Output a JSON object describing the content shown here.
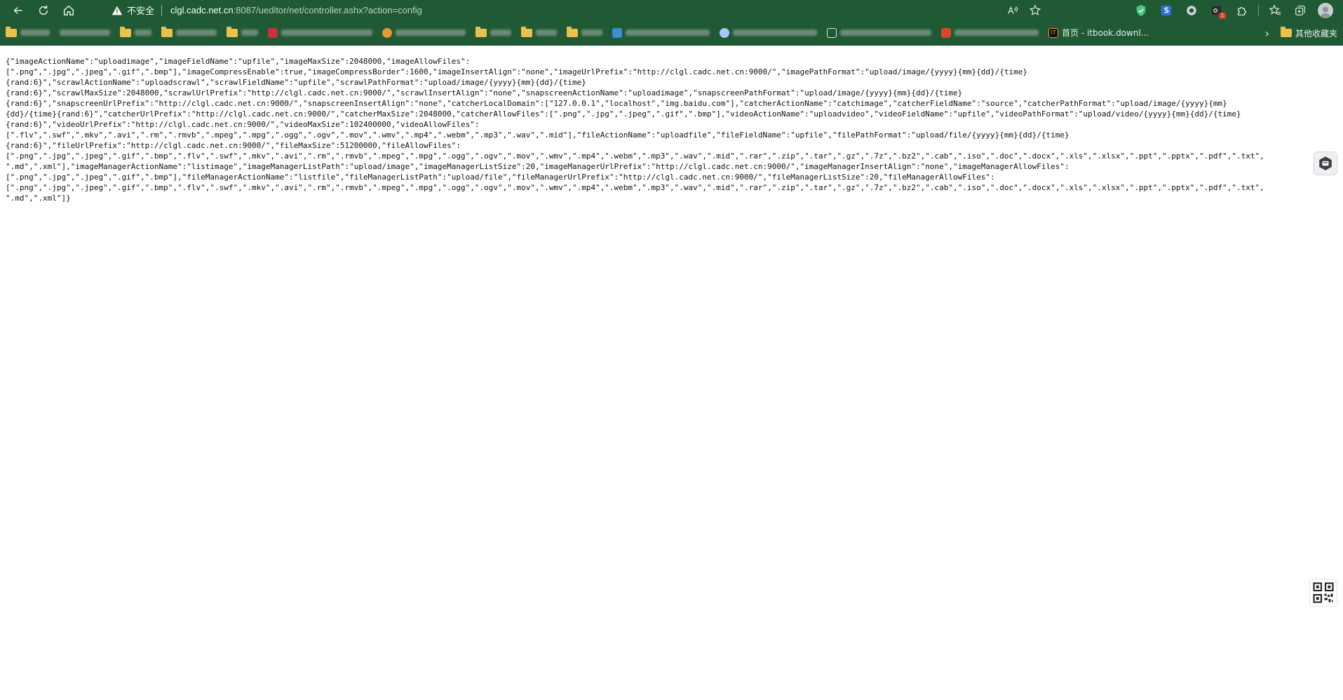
{
  "toolbar": {
    "back_icon": "back-arrow-icon",
    "reload_icon": "reload-icon",
    "home_icon": "home-icon",
    "security_label": "不安全",
    "url_host": "clgl.cadc.net.cn",
    "url_path": ":8087/ueditor/net/controller.ashx?action=config",
    "read_aloud_icon": "read-aloud-icon",
    "add_favorite_icon": "star-add-icon"
  },
  "extensions": [
    "shield-extension-icon",
    "s-extension-icon",
    "circle-extension-icon",
    "badge-extension-icon",
    "puzzle-extension-icon",
    "favorites-icon",
    "collections-icon",
    "profile-avatar-icon"
  ],
  "bookmarks": {
    "named_item": "首页 - itbook.downl...",
    "other_favorites": "其他收藏夹"
  },
  "content": {
    "json_text": "{\"imageActionName\":\"uploadimage\",\"imageFieldName\":\"upfile\",\"imageMaxSize\":2048000,\"imageAllowFiles\":\n[\".png\",\".jpg\",\".jpeg\",\".gif\",\".bmp\"],\"imageCompressEnable\":true,\"imageCompressBorder\":1600,\"imageInsertAlign\":\"none\",\"imageUrlPrefix\":\"http://clgl.cadc.net.cn:9000/\",\"imagePathFormat\":\"upload/image/{yyyy}{mm}{dd}/{time}\n{rand:6}\",\"scrawlActionName\":\"uploadscrawl\",\"scrawlFieldName\":\"upfile\",\"scrawlPathFormat\":\"upload/image/{yyyy}{mm}{dd}/{time}\n{rand:6}\",\"scrawlMaxSize\":2048000,\"scrawlUrlPrefix\":\"http://clgl.cadc.net.cn:9000/\",\"scrawlInsertAlign\":\"none\",\"snapscreenActionName\":\"uploadimage\",\"snapscreenPathFormat\":\"upload/image/{yyyy}{mm}{dd}/{time}\n{rand:6}\",\"snapscreenUrlPrefix\":\"http://clgl.cadc.net.cn:9000/\",\"snapscreenInsertAlign\":\"none\",\"catcherLocalDomain\":[\"127.0.0.1\",\"localhost\",\"img.baidu.com\"],\"catcherActionName\":\"catchimage\",\"catcherFieldName\":\"source\",\"catcherPathFormat\":\"upload/image/{yyyy}{mm}\n{dd}/{time}{rand:6}\",\"catcherUrlPrefix\":\"http://clgl.cadc.net.cn:9000/\",\"catcherMaxSize\":2048000,\"catcherAllowFiles\":[\".png\",\".jpg\",\".jpeg\",\".gif\",\".bmp\"],\"videoActionName\":\"uploadvideo\",\"videoFieldName\":\"upfile\",\"videoPathFormat\":\"upload/video/{yyyy}{mm}{dd}/{time}\n{rand:6}\",\"videoUrlPrefix\":\"http://clgl.cadc.net.cn:9000/\",\"videoMaxSize\":102400000,\"videoAllowFiles\":\n[\".flv\",\".swf\",\".mkv\",\".avi\",\".rm\",\".rmvb\",\".mpeg\",\".mpg\",\".ogg\",\".ogv\",\".mov\",\".wmv\",\".mp4\",\".webm\",\".mp3\",\".wav\",\".mid\"],\"fileActionName\":\"uploadfile\",\"fileFieldName\":\"upfile\",\"filePathFormat\":\"upload/file/{yyyy}{mm}{dd}/{time}\n{rand:6}\",\"fileUrlPrefix\":\"http://clgl.cadc.net.cn:9000/\",\"fileMaxSize\":51200000,\"fileAllowFiles\":\n[\".png\",\".jpg\",\".jpeg\",\".gif\",\".bmp\",\".flv\",\".swf\",\".mkv\",\".avi\",\".rm\",\".rmvb\",\".mpeg\",\".mpg\",\".ogg\",\".ogv\",\".mov\",\".wmv\",\".mp4\",\".webm\",\".mp3\",\".wav\",\".mid\",\".rar\",\".zip\",\".tar\",\".gz\",\".7z\",\".bz2\",\".cab\",\".iso\",\".doc\",\".docx\",\".xls\",\".xlsx\",\".ppt\",\".pptx\",\".pdf\",\".txt\",\n\".md\",\".xml\"],\"imageManagerActionName\":\"listimage\",\"imageManagerListPath\":\"upload/image\",\"imageManagerListSize\":20,\"imageManagerUrlPrefix\":\"http://clgl.cadc.net.cn:9000/\",\"imageManagerInsertAlign\":\"none\",\"imageManagerAllowFiles\":\n[\".png\",\".jpg\",\".jpeg\",\".gif\",\".bmp\"],\"fileManagerActionName\":\"listfile\",\"fileManagerListPath\":\"upload/file\",\"fileManagerUrlPrefix\":\"http://clgl.cadc.net.cn:9000/\",\"fileManagerListSize\":20,\"fileManagerAllowFiles\":\n[\".png\",\".jpg\",\".jpeg\",\".gif\",\".bmp\",\".flv\",\".swf\",\".mkv\",\".avi\",\".rm\",\".rmvb\",\".mpeg\",\".mpg\",\".ogg\",\".ogv\",\".mov\",\".wmv\",\".mp4\",\".webm\",\".mp3\",\".wav\",\".mid\",\".rar\",\".zip\",\".tar\",\".gz\",\".7z\",\".bz2\",\".cab\",\".iso\",\".doc\",\".docx\",\".xls\",\".xlsx\",\".ppt\",\".pptx\",\".pdf\",\".txt\",\n\".md\",\".xml\"]}"
  },
  "colors": {
    "chrome_bg": "#1f5a35",
    "page_bg": "#ffffff",
    "text": "#111111"
  }
}
